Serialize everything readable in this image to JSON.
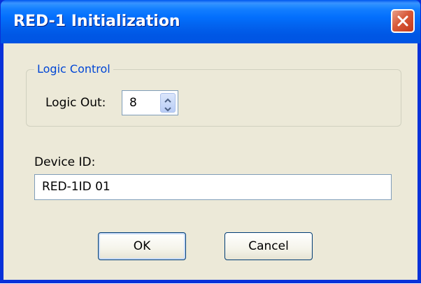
{
  "window": {
    "title": "RED-1 Initialization"
  },
  "logic_control": {
    "legend": "Logic Control",
    "logic_out_label": "Logic Out:",
    "logic_out_value": "8"
  },
  "device": {
    "label": "Device ID:",
    "value": "RED-1ID 01"
  },
  "buttons": {
    "ok_label": "OK",
    "cancel_label": "Cancel"
  },
  "icons": {
    "close": "close-icon",
    "spin_up": "chevron-up-icon",
    "spin_down": "chevron-down-icon"
  },
  "colors": {
    "titlebar": "#0054e3",
    "close_button": "#d85a3a",
    "dialog_bg": "#ece9d8",
    "group_legend": "#0046d5"
  }
}
